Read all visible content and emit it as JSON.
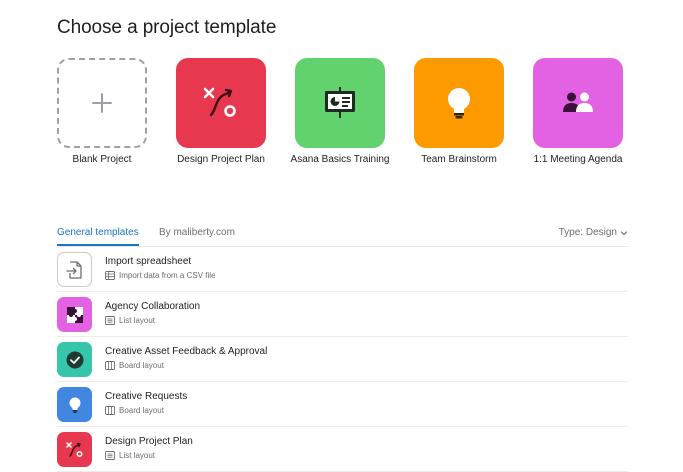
{
  "page": {
    "title": "Choose a project template"
  },
  "cards": [
    {
      "label": "Blank Project",
      "icon": "plus-icon",
      "color": "#ffffff"
    },
    {
      "label": "Design Project Plan",
      "icon": "design-plan-icon",
      "color": "#e8384f"
    },
    {
      "label": "Asana Basics Training",
      "icon": "presentation-board-icon",
      "color": "#62d26f"
    },
    {
      "label": "Team Brainstorm",
      "icon": "lightbulb-icon",
      "color": "#fd9a00"
    },
    {
      "label": "1:1 Meeting Agenda",
      "icon": "two-people-icon",
      "color": "#e362e3"
    }
  ],
  "tabs": {
    "general": "General templates",
    "org": "By maliberty.com",
    "type_filter": "Type: Design"
  },
  "rows": [
    {
      "title": "Import spreadsheet",
      "subtitle": "Import data from a CSV file",
      "icon": "file-import-icon",
      "sub_icon": "spreadsheet-icon",
      "color": "#ffffff"
    },
    {
      "title": "Agency Collaboration",
      "subtitle": "List layout",
      "icon": "puzzle-icon",
      "sub_icon": "list-layout-icon",
      "color": "#e362e3"
    },
    {
      "title": "Creative Asset Feedback & Approval",
      "subtitle": "Board layout",
      "icon": "check-circle-icon",
      "sub_icon": "board-layout-icon",
      "color": "#37c5ab"
    },
    {
      "title": "Creative Requests",
      "subtitle": "Board layout",
      "icon": "lightbulb-icon",
      "sub_icon": "board-layout-icon",
      "color": "#4186e0"
    },
    {
      "title": "Design Project Plan",
      "subtitle": "List layout",
      "icon": "design-plan-icon",
      "sub_icon": "list-layout-icon",
      "color": "#e8384f"
    }
  ]
}
